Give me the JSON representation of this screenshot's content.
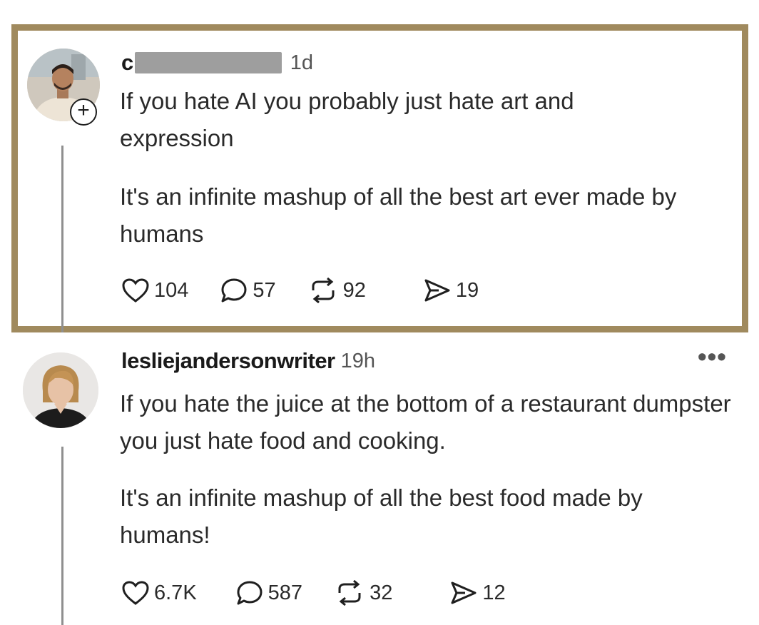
{
  "posts": [
    {
      "username": "c",
      "time": "1d",
      "paragraphs": [
        "If you hate AI you probably just hate art and expression",
        "It's an infinite mashup of all the best art ever made by humans"
      ],
      "likes": "104",
      "replies": "57",
      "reposts": "92",
      "shares": "19"
    },
    {
      "username": "lesliejandersonwriter",
      "time": "19h",
      "paragraphs": [
        "If you hate the juice at the bottom of a restaurant dumpster you just hate food and cooking.",
        "It's an infinite mashup of all the best food made by humans!"
      ],
      "likes": "6.7K",
      "replies": "587",
      "reposts": "32",
      "shares": "12",
      "more": "•••"
    }
  ],
  "icons": {
    "follow": "+",
    "like": "heart-icon",
    "reply": "comment-icon",
    "repost": "repost-icon",
    "share": "send-icon"
  },
  "colors": {
    "highlight_border": "#a08a5e",
    "redaction": "#9e9e9e"
  }
}
